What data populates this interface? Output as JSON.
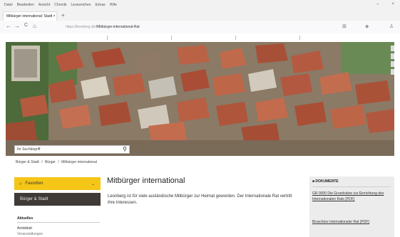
{
  "browser": {
    "menu": [
      "Datei",
      "Bearbeiten",
      "Ansicht",
      "Chronik",
      "Lesezeichen",
      "Extras",
      "Hilfe"
    ],
    "tab_title": "Mitbürger international: Stadt ×",
    "new_tab": "+",
    "url_prefix": "https://leonberg.de/",
    "url_host": "leonberg.de",
    "url_rest": "/Mitbürger-international-Rat",
    "back": "←",
    "forward": "→",
    "reload": "C",
    "home": "⌂",
    "window_controls": [
      "–",
      "×"
    ]
  },
  "search": {
    "placeholder": "Ihr Suchbegriff"
  },
  "breadcrumb": {
    "items": [
      "Bürger & Stadt",
      "/",
      "Bürger",
      "/",
      "Mitbürger international"
    ]
  },
  "sidebar": {
    "favorites_label": "Favoriten",
    "section_label": "Bürger & Stadt",
    "sub_heading": "Aktuelles",
    "item1": "Amtsblatt",
    "item2": "Veranstaltungen"
  },
  "main": {
    "title": "Mitbürger international",
    "intro": "Leonberg ist für viele ausländische Mitbürger zur Heimat geworden. Der Internationale Rat vertritt ihre Interessen."
  },
  "documents": {
    "heading": "DOKUMENTE",
    "items": [
      "GR 0000 Die Grundsätze zur Einrichtung des Internationalen Rats (PDF)",
      "Broschüre Internationaler Rat (PDF)"
    ]
  },
  "colors": {
    "accent_yellow": "#f5c618",
    "dark_sidebar": "#3f3a36",
    "search_strip": "#7a6a58"
  }
}
